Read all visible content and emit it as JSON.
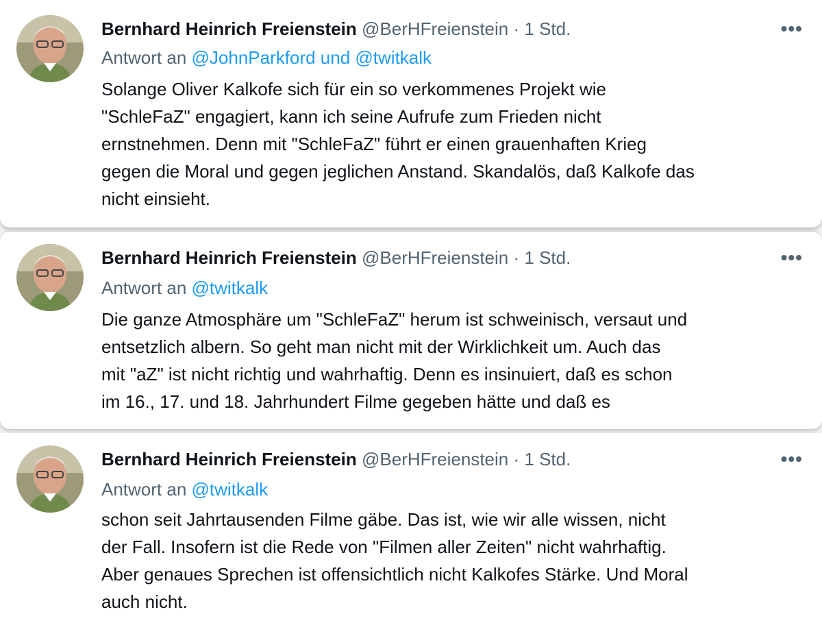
{
  "tweets": [
    {
      "name": "Bernhard Heinrich Freienstein",
      "handle": "@BerHFreienstein",
      "separator": "·",
      "time": "1 Std.",
      "more": "•••",
      "reply_prefix": "Antwort an",
      "reply_to": "@JohnParkford und @twitkalk",
      "lines": [
        "Solange Oliver Kalkofe sich für ein so verkommenes Projekt wie",
        "\"SchleFaZ\" engagiert, kann ich seine Aufrufe zum Frieden nicht",
        "ernstnehmen. Denn mit \"SchleFaZ\" führt er einen grauenhaften Krieg",
        "gegen die Moral und gegen jeglichen Anstand. Skandalös, daß Kalkofe das",
        "nicht einsieht."
      ]
    },
    {
      "name": "Bernhard Heinrich Freienstein",
      "handle": "@BerHFreienstein",
      "separator": "·",
      "time": "1 Std.",
      "more": "•••",
      "reply_prefix": "Antwort an",
      "reply_to": "@twitkalk",
      "lines": [
        "Die ganze Atmosphäre um \"SchleFaZ\" herum ist schweinisch, versaut und",
        "entsetzlich albern. So geht man nicht mit der Wirklichkeit um. Auch das",
        "mit \"aZ\" ist nicht richtig und wahrhaftig. Denn es insinuiert, daß es schon",
        "im 16., 17. und 18. Jahrhundert Filme gegeben hätte und daß es"
      ]
    },
    {
      "name": "Bernhard Heinrich Freienstein",
      "handle": "@BerHFreienstein",
      "separator": "·",
      "time": "1 Std.",
      "more": "•••",
      "reply_prefix": "Antwort an",
      "reply_to": "@twitkalk",
      "lines": [
        "schon seit Jahrtausenden Filme gäbe. Das ist, wie wir alle wissen, nicht",
        "der Fall. Insofern ist die Rede von \"Filmen aller Zeiten\" nicht wahrhaftig.",
        "Aber genaues Sprechen ist offensichtlich nicht Kalkofes Stärke. Und Moral",
        "auch nicht."
      ]
    }
  ],
  "colors": {
    "text": "#0f1419",
    "secondary": "#536471",
    "link": "#1d9bf0"
  }
}
